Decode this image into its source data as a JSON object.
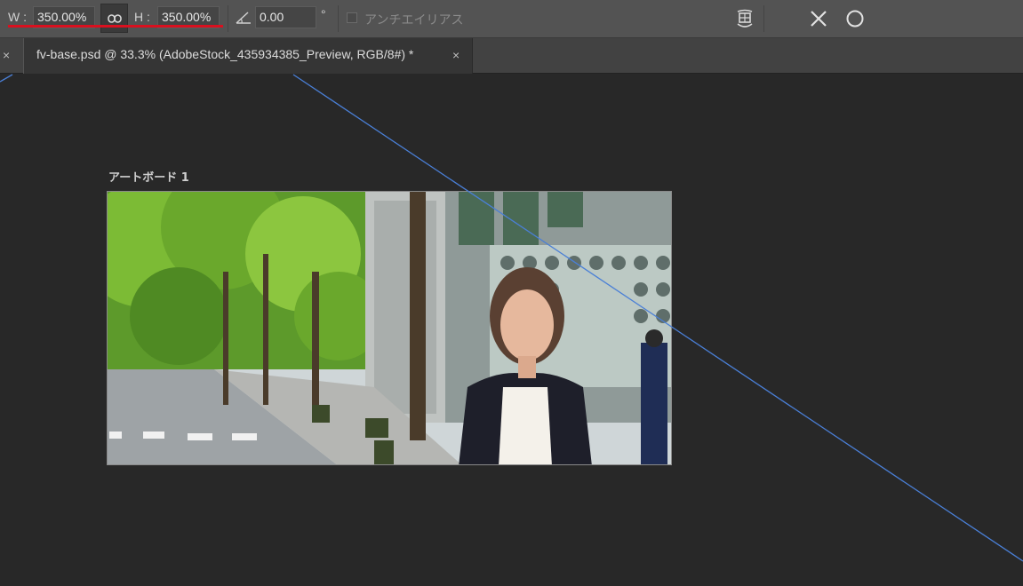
{
  "options_bar": {
    "w_label": "W :",
    "w_value": "350.00%",
    "h_label": "H :",
    "h_value": "350.00%",
    "angle_value": "0.00",
    "angle_unit": "°",
    "antialias_label": "アンチエイリアス",
    "link_icon": "link-icon",
    "angle_icon": "angle-icon",
    "warp_icon": "warp-icon",
    "cancel_icon": "cancel-icon",
    "commit_icon": "commit-icon"
  },
  "tabs": {
    "prev_close": "×",
    "active_title": "fv-base.psd @ 33.3% (AdobeStock_435934385_Preview, RGB/8#) *",
    "active_close": "×"
  },
  "canvas": {
    "artboard_label": "アートボード 1"
  },
  "colors": {
    "app_bg": "#282828",
    "options_bg": "#535353",
    "highlight_red": "#d9101f",
    "guide_blue": "#4a7fd6"
  }
}
